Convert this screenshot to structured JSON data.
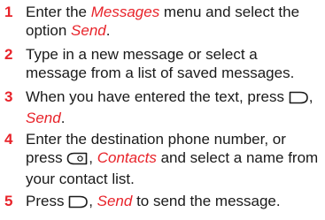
{
  "colors": {
    "accent": "#e8232a",
    "step_number": "#e8232a",
    "text": "#1a1a1a"
  },
  "steps": [
    {
      "number": "1",
      "p1": "Enter the ",
      "em1": "Messages",
      "p2": " menu and select the option ",
      "em2": "Send",
      "p3": "."
    },
    {
      "number": "2",
      "p1": "Type in a new message or select a message from a list of saved messages."
    },
    {
      "number": "3",
      "p1": "When you have entered the text, press ",
      "icon": "right-softkey-icon",
      "p2": ", ",
      "em1": "Send",
      "p3": "."
    },
    {
      "number": "4",
      "p1": "Enter the destination phone number, or press ",
      "icon": "left-softkey-icon",
      "p2": ", ",
      "em1": "Contacts",
      "p3": " and select a name from your contact list."
    },
    {
      "number": "5",
      "p1": "Press ",
      "icon": "right-softkey-icon",
      "p2": ", ",
      "em1": "Send",
      "p3": " to send the message."
    }
  ]
}
